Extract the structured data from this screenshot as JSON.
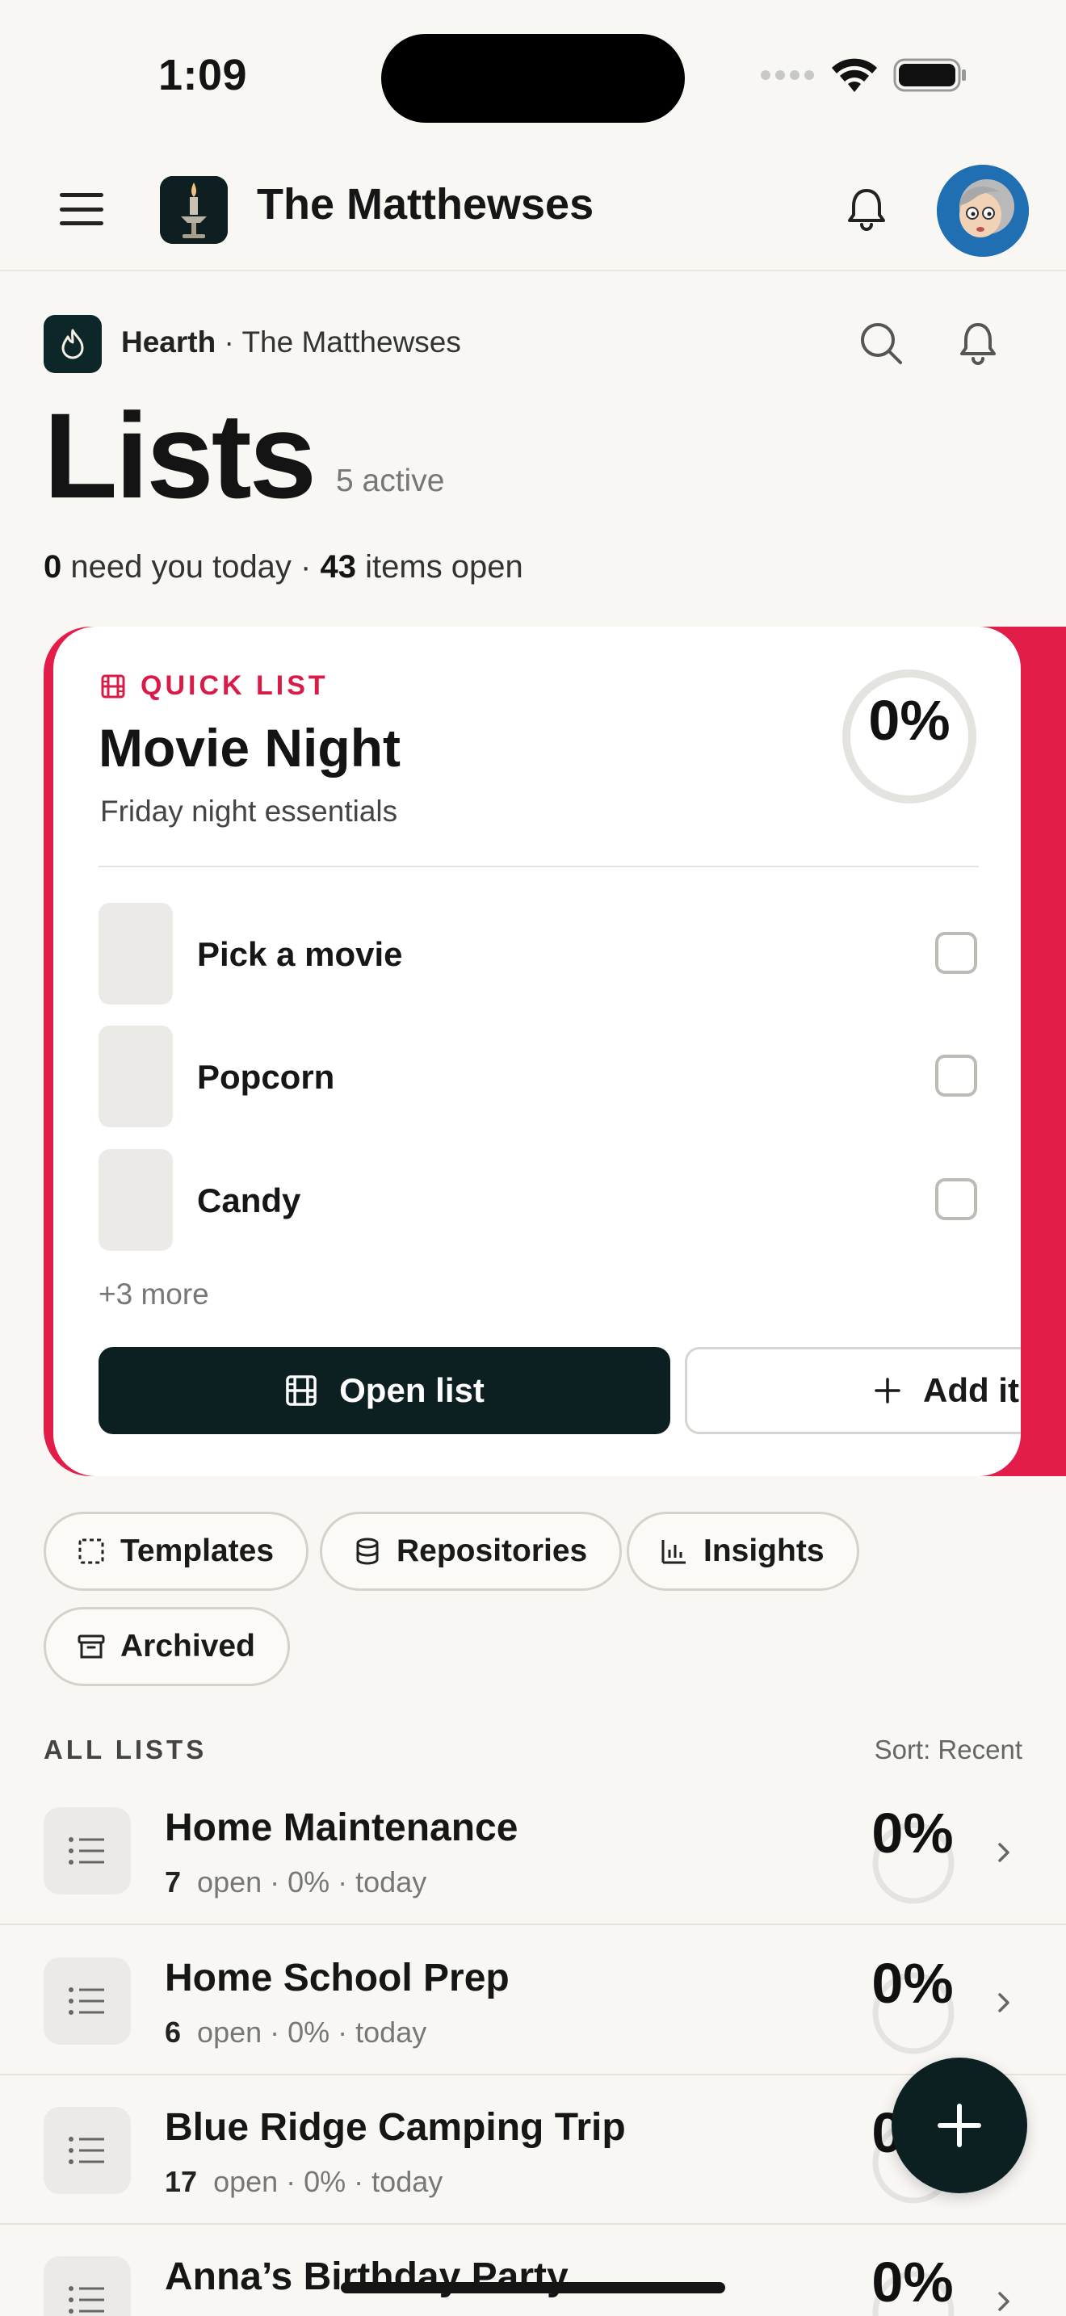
{
  "status_bar": {
    "time": "1:09"
  },
  "app_header": {
    "household_name": "The Matthewses"
  },
  "breadcrumb": {
    "brand": "Hearth",
    "separator": "·",
    "household": "The Matthewses"
  },
  "page": {
    "title": "Lists",
    "active_count": "5 active",
    "summary_need_count": "0",
    "summary_need_text": "need you today ·",
    "summary_open_count": "43",
    "summary_open_text": "items open"
  },
  "quick_list": {
    "label": "QUICK LIST",
    "title": "Movie Night",
    "subtitle": "Friday night essentials",
    "progress_text": "0%",
    "progress": 0,
    "items": [
      {
        "label": "Pick a movie",
        "checked": false
      },
      {
        "label": "Popcorn",
        "checked": false
      },
      {
        "label": "Candy",
        "checked": false
      }
    ],
    "more_text": "+3 more",
    "open_button": "Open list",
    "add_button": "Add it",
    "accent_color": "#e21d48"
  },
  "chips": [
    {
      "label": "Templates",
      "icon": "template-icon"
    },
    {
      "label": "Repositories",
      "icon": "database-icon"
    },
    {
      "label": "Insights",
      "icon": "bar-chart-icon"
    },
    {
      "label": "Archived",
      "icon": "archive-icon"
    }
  ],
  "all_lists": {
    "section_label": "ALL LISTS",
    "sort_label": "Sort: Recent",
    "items": [
      {
        "name": "Home Maintenance",
        "open_count": "7",
        "meta": "open · 0% · today",
        "percent_text": "0%",
        "progress": 0
      },
      {
        "name": "Home School Prep",
        "open_count": "6",
        "meta": "open · 0% · today",
        "percent_text": "0%",
        "progress": 0
      },
      {
        "name": "Blue Ridge Camping Trip",
        "open_count": "17",
        "meta": "open · 0% · today",
        "percent_text": "0%",
        "progress": 0
      },
      {
        "name": "Anna’s Birthday Party",
        "open_count": "",
        "meta": "",
        "percent_text": "0%",
        "progress": 0
      }
    ]
  },
  "colors": {
    "dark_teal": "#0c1f21",
    "background": "#f8f7f4",
    "accent": "#e21d48"
  }
}
